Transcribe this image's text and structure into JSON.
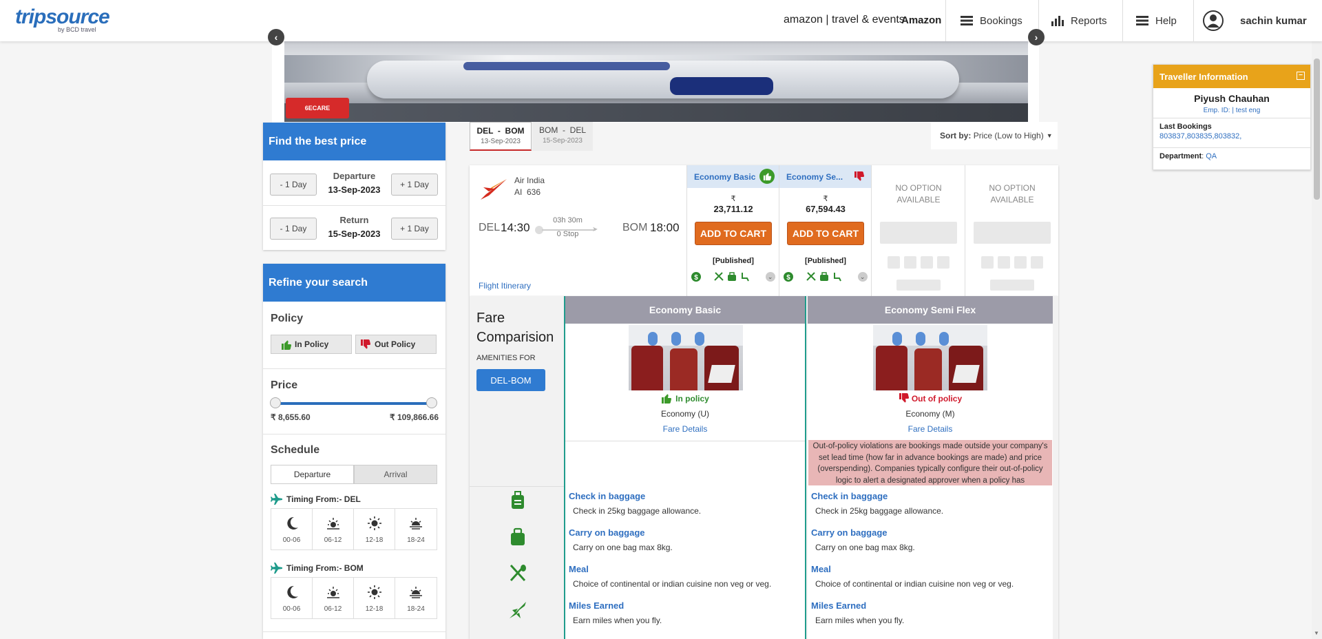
{
  "header": {
    "logo_main": "tripsource",
    "logo_sub": "by BCD travel",
    "partner": "amazon | travel & events",
    "company": "Amazon",
    "nav": [
      {
        "label": "Bookings",
        "icon": "menu-icon"
      },
      {
        "label": "Reports",
        "icon": "bar-chart-icon"
      },
      {
        "label": "Help",
        "icon": "menu-icon"
      }
    ],
    "user": "sachin kumar"
  },
  "banner": {
    "badge": "6ECARE"
  },
  "find_price": {
    "title": "Find the best price",
    "minus_label": "- 1 Day",
    "plus_label": "+ 1 Day",
    "departure_label": "Departure",
    "departure_date": "13-Sep-2023",
    "return_label": "Return",
    "return_date": "15-Sep-2023"
  },
  "refine": {
    "title": "Refine your search",
    "policy_title": "Policy",
    "in_policy": "In Policy",
    "out_policy": "Out Policy",
    "price_title": "Price",
    "price_min": "₹ 8,655.60",
    "price_max": "₹ 109,866.66",
    "price_range_fraction": [
      0,
      1
    ],
    "schedule_title": "Schedule",
    "tab_departure": "Departure",
    "tab_arrival": "Arrival",
    "timing_from_1": "Timing From:- DEL",
    "timing_from_2": "Timing From:- BOM",
    "slots": [
      "00-06",
      "06-12",
      "12-18",
      "18-24"
    ]
  },
  "route_tabs": [
    {
      "route": "DEL  -  BOM",
      "date": "13-Sep-2023",
      "active": true
    },
    {
      "route": "BOM  -  DEL",
      "date": "15-Sep-2023",
      "active": false
    }
  ],
  "sort": {
    "label": "Sort by:",
    "value": "Price (Low to High)"
  },
  "flight": {
    "airline": "Air India",
    "flight_no": "AI  636",
    "from": "DEL",
    "dep_time": "14:30",
    "duration": "03h 30m",
    "stops": "0 Stop",
    "to": "BOM",
    "arr_time": "18:00",
    "itinerary_link": "Flight Itinerary",
    "fares": [
      {
        "name": "Economy Basic",
        "currency": "₹",
        "price": "23,711.12",
        "cta": "ADD TO CART",
        "tag": "[Published]",
        "policy": "in"
      },
      {
        "name": "Economy Se...",
        "currency": "₹",
        "price": "67,594.43",
        "cta": "ADD TO CART",
        "tag": "[Published]",
        "policy": "out"
      }
    ],
    "no_option": "NO OPTION AVAILABLE"
  },
  "fare_comparison": {
    "title_line1": "Fare",
    "title_line2": "Comparision",
    "amenities_for": "AMENITIES FOR",
    "route_btn": "DEL-BOM",
    "columns": [
      {
        "name": "Economy Basic",
        "policy_label": "In policy",
        "class": "Economy (U)",
        "details": "Fare Details",
        "note": ""
      },
      {
        "name": "Economy Semi Flex",
        "policy_label": "Out of policy",
        "class": "Economy (M)",
        "details": "Fare Details",
        "note": "Out-of-policy violations are bookings made outside your company's set lead time (how far in advance bookings are made) and price (overspending). Companies typically configure their out-of-policy logic to alert a designated approver when a policy has"
      }
    ],
    "amenities": [
      {
        "title": "Check in baggage",
        "desc": "Check in 25kg baggage allowance.",
        "icon": "suitcase-icon"
      },
      {
        "title": "Carry on baggage",
        "desc": "Carry on one bag max 8kg.",
        "icon": "bag-icon"
      },
      {
        "title": "Meal",
        "desc": "Choice of continental or indian cuisine non veg or veg.",
        "icon": "meal-icon"
      },
      {
        "title": "Miles Earned",
        "desc": "Earn miles when you fly.",
        "icon": "plane-icon"
      }
    ]
  },
  "traveller": {
    "title": "Traveller Information",
    "name": "Piyush Chauhan",
    "emp": "Emp. ID: | test eng",
    "last_bookings_label": "Last Bookings",
    "last_bookings": "803837,803835,803832,",
    "department_label": "Department",
    "department": "QA"
  },
  "colors": {
    "brand_blue": "#2f7bd1",
    "orange": "#e06b1f",
    "green": "#2e8b2e",
    "red": "#d0192b",
    "gold": "#e8a31a",
    "teal": "#1f9c8c"
  }
}
